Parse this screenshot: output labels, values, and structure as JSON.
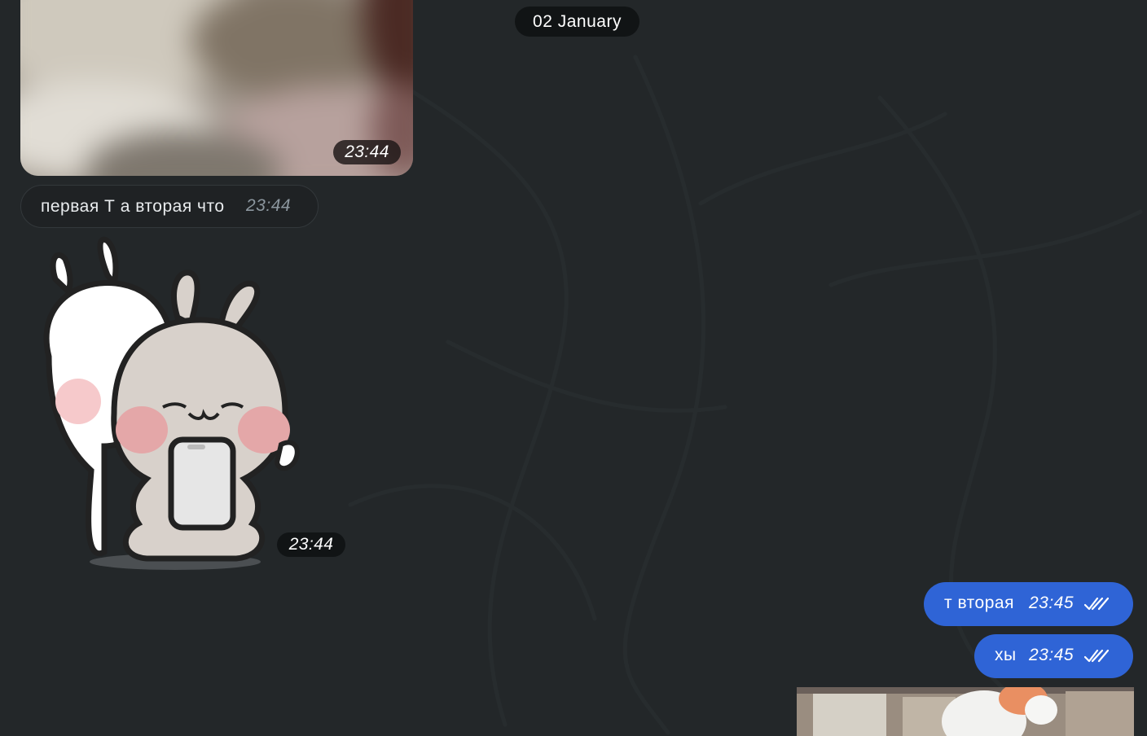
{
  "chat": {
    "date_separator": "02 January",
    "messages": [
      {
        "type": "photo",
        "direction": "incoming",
        "time": "23:44"
      },
      {
        "type": "text",
        "direction": "incoming",
        "text": "первая Т а вторая что",
        "time": "23:44"
      },
      {
        "type": "sticker",
        "direction": "incoming",
        "time": "23:44"
      },
      {
        "type": "text",
        "direction": "outgoing",
        "text": "т вторая",
        "time": "23:45",
        "status": "read"
      },
      {
        "type": "text",
        "direction": "outgoing",
        "text": "хы",
        "time": "23:45",
        "status": "read"
      },
      {
        "type": "photo",
        "direction": "outgoing"
      }
    ]
  },
  "colors": {
    "background": "#232729",
    "incoming_bubble": "#1f2224",
    "outgoing_bubble": "#2f64d6",
    "date_pill": "#111415"
  },
  "icons": {
    "read_status": "double-check-icon"
  }
}
